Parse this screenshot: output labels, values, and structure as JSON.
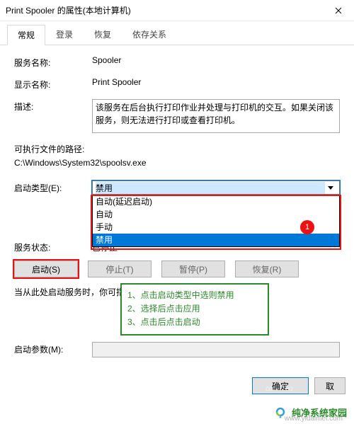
{
  "window": {
    "title": "Print Spooler 的属性(本地计算机)"
  },
  "tabs": {
    "general": "常规",
    "logon": "登录",
    "recovery": "恢复",
    "dependencies": "依存关系"
  },
  "labels": {
    "service_name": "服务名称:",
    "display_name": "显示名称:",
    "description": "描述:",
    "exec_path": "可执行文件的路径:",
    "startup_type": "启动类型(E):",
    "service_status": "服务状态:",
    "note": "当从此处启动服务时，你可指定所适用的启动参数。",
    "start_params": "启动参数(M):"
  },
  "values": {
    "service_name": "Spooler",
    "display_name": "Print Spooler",
    "description": "该服务在后台执行打印作业并处理与打印机的交互。如果关闭该服务，则无法进行打印或查看打印机。",
    "exec_path": "C:\\Windows\\System32\\spoolsv.exe",
    "startup_selected": "禁用",
    "service_status": "已停止"
  },
  "dropdown": {
    "opt_auto_delayed": "自动(延迟启动)",
    "opt_auto": "自动",
    "opt_manual": "手动",
    "opt_disabled": "禁用"
  },
  "buttons": {
    "start": "启动(S)",
    "stop": "停止(T)",
    "pause": "暂停(P)",
    "resume": "恢复(R)",
    "ok": "确定",
    "cancel": "取"
  },
  "annotations": {
    "badge1": "1",
    "tip1": "1、点击启动类型中选则禁用",
    "tip2": "2、选择后点击应用",
    "tip3": "3、点击后点击启动"
  },
  "brand": {
    "name": "纯净系统家园",
    "url": "www.yidaimei.com"
  }
}
